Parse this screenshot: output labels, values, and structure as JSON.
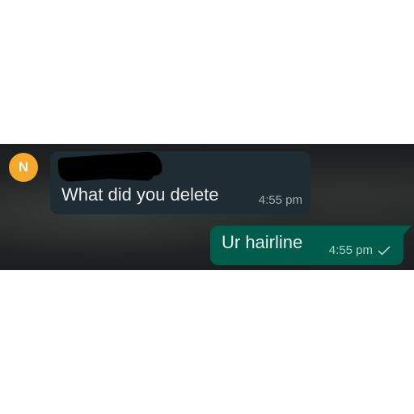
{
  "incoming": {
    "avatar_initial": "N",
    "sender_name": "",
    "text": "What did you delete",
    "time": "4:55 pm"
  },
  "outgoing": {
    "text": "Ur hairline",
    "time": "4:55 pm",
    "status_icon": "single-check-icon"
  },
  "colors": {
    "avatar": "#f4a92a",
    "incoming_bubble": "#1f2c33",
    "outgoing_bubble": "#005c4b",
    "chat_background": "#1f2322"
  }
}
